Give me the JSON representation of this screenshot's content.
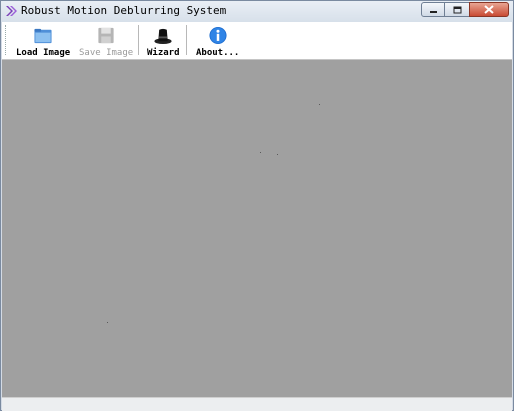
{
  "window": {
    "title": "Robust Motion Deblurring System"
  },
  "toolbar": {
    "buttons": [
      {
        "label": "Load Image",
        "icon": "folder-icon",
        "enabled": true
      },
      {
        "label": "Save Image",
        "icon": "floppy-disk-icon",
        "enabled": false
      },
      {
        "label": "Wizard",
        "icon": "wizard-hat-icon",
        "enabled": true
      },
      {
        "label": "About...",
        "icon": "info-icon",
        "enabled": true
      }
    ]
  },
  "colors": {
    "canvas": "#a0a0a0",
    "close_button": "#c94a33",
    "info_icon": "#1f6fd1"
  }
}
